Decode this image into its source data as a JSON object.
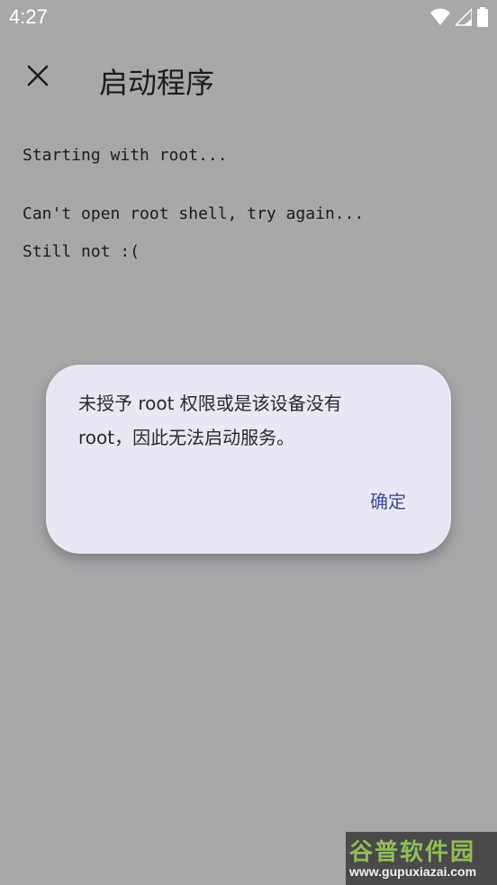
{
  "status_bar": {
    "time": "4:27",
    "icons": [
      "wifi-icon",
      "cell-signal-icon",
      "battery-icon"
    ]
  },
  "app_bar": {
    "close_icon": "close-icon",
    "title": "启动程序"
  },
  "log": {
    "lines": [
      "Starting with root...",
      "Can't open root shell, try again...",
      "Still not :("
    ]
  },
  "dialog": {
    "message_line1": "未授予 root 权限或是该设备没有",
    "message_line2": "root，因此无法启动服务。",
    "confirm_label": "确定"
  },
  "watermark": {
    "brand": "谷普软件园",
    "url": "www.gupuxiazai.com"
  },
  "colors": {
    "background": "#a8a7aa",
    "dialog_background": "#e8e7f3",
    "accent": "#3f4da3"
  }
}
